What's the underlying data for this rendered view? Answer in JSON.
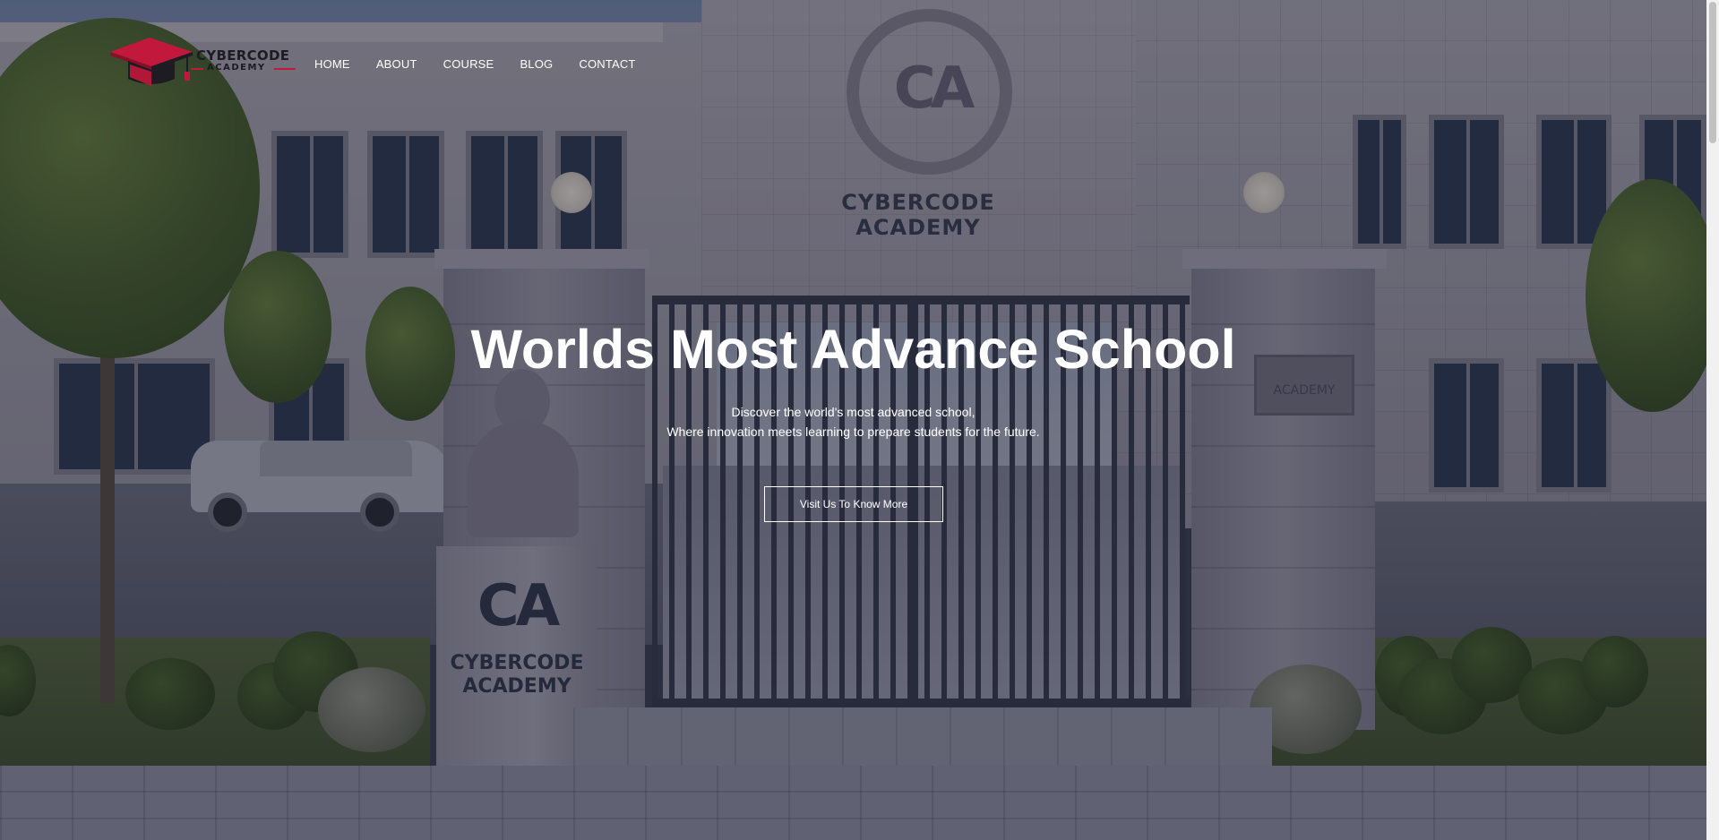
{
  "brand": {
    "name_line1": "CYBERCODE",
    "name_line2": "ACADEMY",
    "accent_color": "#c2183b",
    "icon": "graduation-cap-icon"
  },
  "nav": {
    "items": [
      {
        "label": "HOME"
      },
      {
        "label": "ABOUT"
      },
      {
        "label": "COURSE"
      },
      {
        "label": "BLOG"
      },
      {
        "label": "CONTACT"
      }
    ]
  },
  "hero": {
    "title": "Worlds Most Advance School",
    "subtitle_line1": "Discover the world's most advanced school,",
    "subtitle_line2": "Where innovation meets learning to prepare students for the future.",
    "cta_label": "Visit Us To Know More",
    "background": {
      "emblem_letters": "CA",
      "wall_sign": "CYBERCODE ACADEMY",
      "plinth_letters": "CA",
      "plinth_line1": "CYBERCODE",
      "plinth_line2": "ACADEMY",
      "plaque_text": "ACADEMY"
    }
  }
}
